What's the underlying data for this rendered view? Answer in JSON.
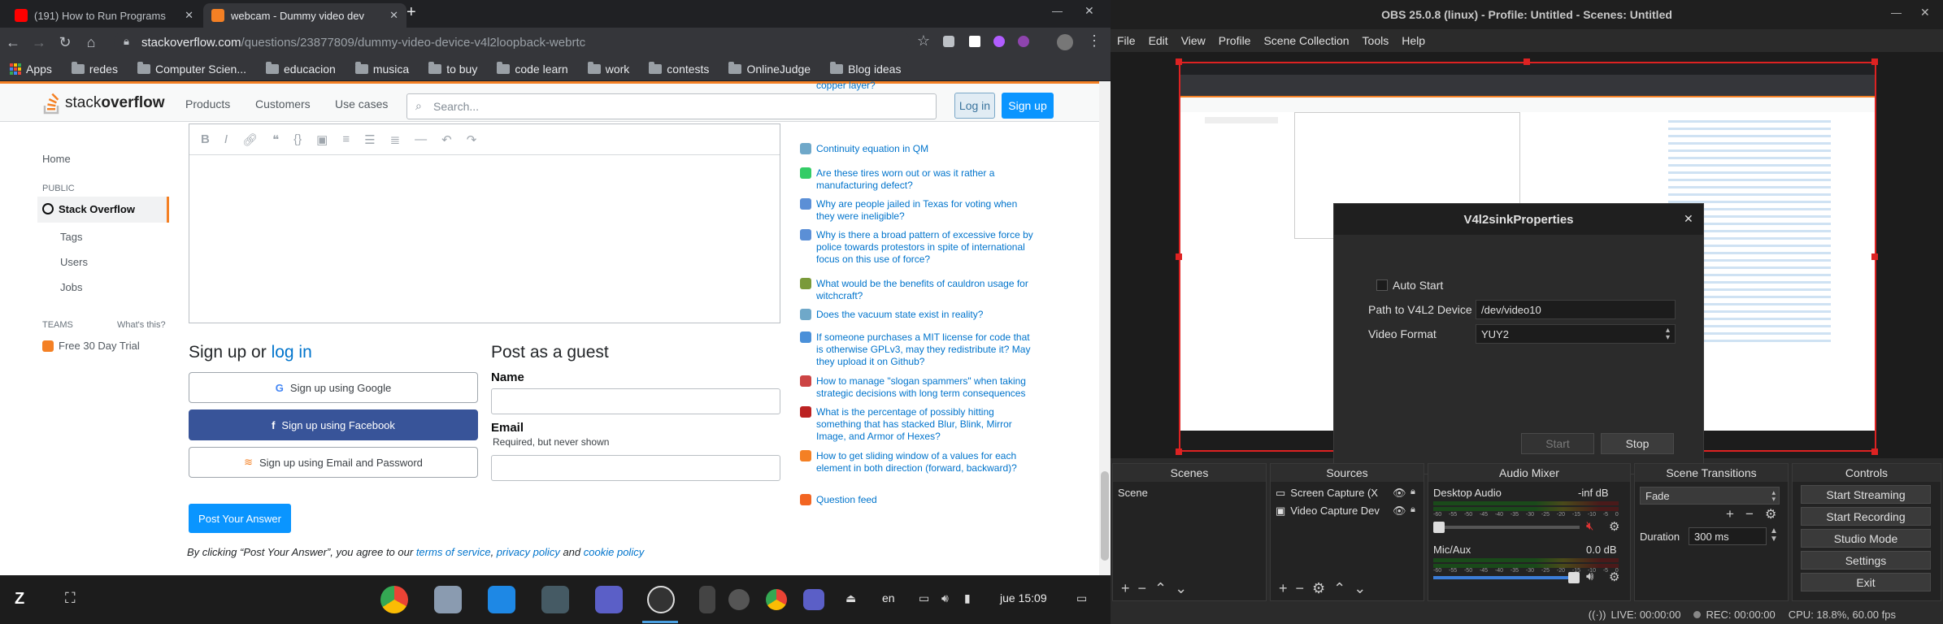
{
  "browser": {
    "tabs": [
      {
        "title": "(191) How to Run Programs",
        "favicon_color": "#ff0000"
      },
      {
        "title": "webcam - Dummy video dev",
        "favicon_color": "#f48024"
      }
    ],
    "new_tab": "+",
    "url_host": "stackoverflow.com",
    "url_path": "/questions/23877809/dummy-video-device-v4l2loopback-webrtc",
    "bookmarks": [
      "Apps",
      "redes",
      "Computer Scien...",
      "educacion",
      "musica",
      "to buy",
      "code learn",
      "work",
      "contests",
      "OnlineJudge",
      "Blog ideas"
    ]
  },
  "so": {
    "logo_text_a": "stack",
    "logo_text_b": "overflow",
    "topnav": [
      "Products",
      "Customers",
      "Use cases"
    ],
    "search_placeholder": "Search...",
    "login": "Log in",
    "signup": "Sign up",
    "sidebar": {
      "home": "Home",
      "public": "PUBLIC",
      "stack_overflow": "Stack Overflow",
      "tags": "Tags",
      "users": "Users",
      "jobs": "Jobs",
      "teams": "TEAMS",
      "whats_this": "What's this?",
      "trial": "Free 30 Day Trial"
    },
    "signup_heading": "Sign up or",
    "signup_login_link": "log in",
    "google": "Sign up using Google",
    "facebook": "Sign up using Facebook",
    "email_pw": "Sign up using Email and Password",
    "guest_heading": "Post as a guest",
    "name_label": "Name",
    "email_label": "Email",
    "email_hint": "Required, but never shown",
    "post_button": "Post Your Answer",
    "terms_prefix": "By clicking “Post Your Answer”, you agree to our",
    "terms": "terms of service",
    "privacy": "privacy policy",
    "and": "and",
    "cookie": "cookie policy",
    "hot_questions": [
      "copper layer?",
      "Continuity equation in QM",
      "Are these tires worn out or was it rather a manufacturing defect?",
      "Why are people jailed in Texas for voting when they were ineligible?",
      "Why is there a broad pattern of excessive force by police towards protestors in spite of international focus on this use of force?",
      "What would be the benefits of cauldron usage for witchcraft?",
      "Does the vacuum state exist in reality?",
      "If someone purchases a MIT license for code that is otherwise GPLv3, may they redistribute it? May they upload it on Github?",
      "How to manage \"slogan spammers\" when taking strategic decisions with long term consequences",
      "What is the percentage of possibly hitting something that has stacked Blur, Blink, Mirror Image, and Armor of Hexes?",
      "How to get sliding window of a values for each element in both direction (forward, backward)?"
    ],
    "question_feed": "Question feed"
  },
  "taskbar": {
    "lang": "en",
    "clock": "jue 15:09"
  },
  "obs": {
    "title": "OBS 25.0.8 (linux) - Profile: Untitled - Scenes: Untitled",
    "menu": [
      "File",
      "Edit",
      "View",
      "Profile",
      "Scene Collection",
      "Tools",
      "Help"
    ],
    "dialog": {
      "title": "V4l2sinkProperties",
      "auto_start": "Auto Start",
      "path_label": "Path to V4L2 Device",
      "path_value": "/dev/video10",
      "format_label": "Video Format",
      "format_value": "YUY2",
      "start": "Start",
      "stop": "Stop"
    },
    "docks": {
      "scenes": "Scenes",
      "scene_item": "Scene",
      "sources": "Sources",
      "source_items": [
        "Screen Capture (X",
        "Video Capture Dev"
      ],
      "mixer": "Audio Mixer",
      "desktop_audio": "Desktop Audio",
      "desktop_db": "-inf dB",
      "mic": "Mic/Aux",
      "mic_db": "0.0 dB",
      "scale": [
        "-60",
        "-55",
        "-50",
        "-45",
        "-40",
        "-35",
        "-30",
        "-25",
        "-20",
        "-15",
        "-10",
        "-5",
        "0"
      ],
      "transitions": "Scene Transitions",
      "fade": "Fade",
      "duration_label": "Duration",
      "duration_value": "300 ms",
      "controls": "Controls",
      "buttons": [
        "Start Streaming",
        "Start Recording",
        "Studio Mode",
        "Settings",
        "Exit"
      ]
    },
    "status": {
      "live": "LIVE: 00:00:00",
      "rec": "REC: 00:00:00",
      "cpu": "CPU: 18.8%, 60.00 fps"
    }
  }
}
